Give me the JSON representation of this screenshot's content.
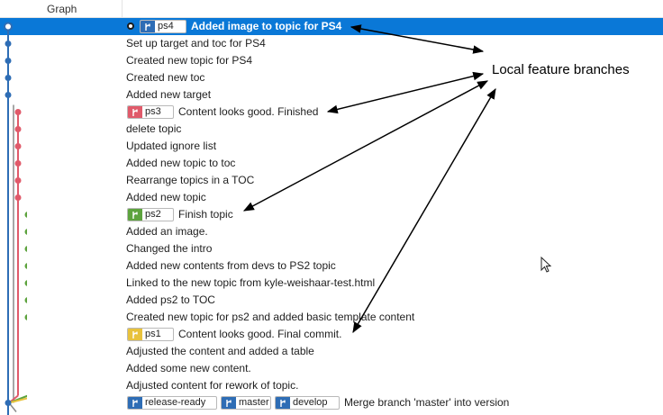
{
  "header": {
    "graph_label": "Graph"
  },
  "annotation": {
    "text": "Local feature branches"
  },
  "colors": {
    "selection": "#0a78d7",
    "branch_blue": "#2e6db5",
    "branch_red": "#e05a6a",
    "branch_green": "#5da33e",
    "branch_yellow": "#e8c23c",
    "branch_gray": "#8a8a8a"
  },
  "commits": [
    {
      "message": "Added image to topic for PS4",
      "selected": true,
      "head": true,
      "refs": [
        {
          "label": "ps4",
          "color": "blue",
          "icon": "branch-icon"
        }
      ]
    },
    {
      "message": "Set up target and toc for PS4",
      "refs": []
    },
    {
      "message": "Created new topic for PS4",
      "refs": []
    },
    {
      "message": "Created new toc",
      "refs": []
    },
    {
      "message": "Added new target",
      "refs": []
    },
    {
      "message": "Content looks good. Finished",
      "refs": [
        {
          "label": "ps3",
          "color": "red",
          "icon": "branch-icon"
        }
      ]
    },
    {
      "message": "delete topic",
      "refs": []
    },
    {
      "message": "Updated ignore list",
      "refs": []
    },
    {
      "message": "Added new topic to toc",
      "refs": []
    },
    {
      "message": "Rearrange topics in a TOC",
      "refs": []
    },
    {
      "message": "Added new topic",
      "refs": []
    },
    {
      "message": "Finish topic",
      "refs": [
        {
          "label": "ps2",
          "color": "green",
          "icon": "branch-icon"
        }
      ]
    },
    {
      "message": "Added an image.",
      "refs": []
    },
    {
      "message": "Changed the intro",
      "refs": []
    },
    {
      "message": "Added new contents from devs to PS2 topic",
      "refs": []
    },
    {
      "message": "Linked to the new topic from kyle-weishaar-test.html",
      "refs": []
    },
    {
      "message": "Added ps2 to TOC",
      "refs": []
    },
    {
      "message": "Created new topic for ps2 and added basic template content",
      "refs": []
    },
    {
      "message": "Content looks good. Final commit.",
      "refs": [
        {
          "label": "ps1",
          "color": "yellow",
          "icon": "branch-icon"
        }
      ]
    },
    {
      "message": "Adjusted the content and added a table",
      "refs": []
    },
    {
      "message": "Added some new content.",
      "refs": []
    },
    {
      "message": "Adjusted content for rework of topic.",
      "refs": []
    },
    {
      "message": "Merge branch 'master' into version",
      "refs": [
        {
          "label": "release-ready",
          "color": "blue",
          "icon": "branch-icon"
        },
        {
          "label": "master",
          "color": "blue",
          "icon": "branch-icon"
        },
        {
          "label": "develop",
          "color": "blue",
          "icon": "branch-icon"
        }
      ]
    }
  ]
}
